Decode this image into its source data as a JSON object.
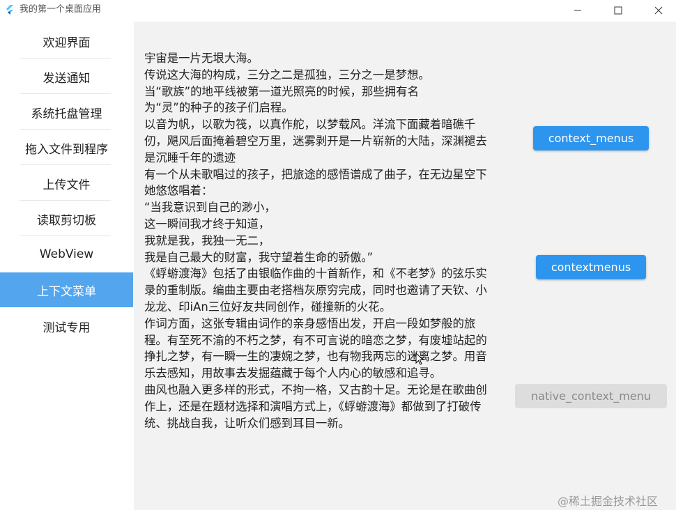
{
  "window": {
    "title": "我的第一个桌面应用",
    "accent_color": "#53a6ee"
  },
  "sidebar": {
    "items": [
      {
        "label": "欢迎界面"
      },
      {
        "label": "发送通知"
      },
      {
        "label": "系统托盘管理"
      },
      {
        "label": "拖入文件到程序"
      },
      {
        "label": "上传文件"
      },
      {
        "label": "读取剪切板"
      },
      {
        "label": "WebView"
      },
      {
        "label": "上下文菜单"
      },
      {
        "label": "测试专用"
      }
    ],
    "active_label": "上下文菜单"
  },
  "main": {
    "lines": [
      "宇宙是一片无垠大海。",
      "传说这大海的构成，三分之二是孤独，三分之一是梦想。",
      "当“歌族”的地平线被第一道光照亮的时候，那些拥有名",
      "为“灵”的种子的孩子们启程。",
      "以音为帆，以歌为筏，以真作舵，以梦载风。洋流下面藏着暗礁千仞，飓风后面掩着碧空万里，迷雾剥开是一片崭新的大陆，深渊褪去是沉睡千年的遗迹",
      "有一个从未歌唱过的孩子，把旅途的感悟谱成了曲子，在无边星空下她悠悠唱着：",
      "“当我意识到自己的渺小，",
      "这一瞬间我才终于知道，",
      "我就是我，我独一无二，",
      "我是自己最大的财富，我守望着生命的骄傲。”",
      "《蜉蝣渡海》包括了由银临作曲的十首新作，和《不老梦》的弦乐实录的重制版。编曲主要由老搭档灰原穷完成，同时也邀请了天钦、小龙龙、印iAn三位好友共同创作，碰撞新的火花。",
      "作词方面，这张专辑由词作的亲身感悟出发，开启一段如梦般的旅程。有至死不渝的不朽之梦，有不可言说的暗恋之梦，有废墟站起的挣扎之梦，有一瞬一生的凄婉之梦，也有物我两忘的迷离之梦。用音乐去感知，用故事去发掘蕴藏于每个人内心的敏感和追寻。",
      "曲风也融入更多样的形式，不拘一格，又古韵十足。无论是在歌曲创作上，还是在题材选择和演唱方式上，《蜉蝣渡海》都做到了打破传统、挑战自我，让听众们感到耳目一新。"
    ],
    "buttons": {
      "context_menus": "context_menus",
      "contextmenus": "contextmenus",
      "native_context_menu": "native_context_menu"
    },
    "primary_color": "#2e95ee",
    "disabled_color": "#dddddd"
  },
  "watermark": "@稀土掘金技术社区"
}
